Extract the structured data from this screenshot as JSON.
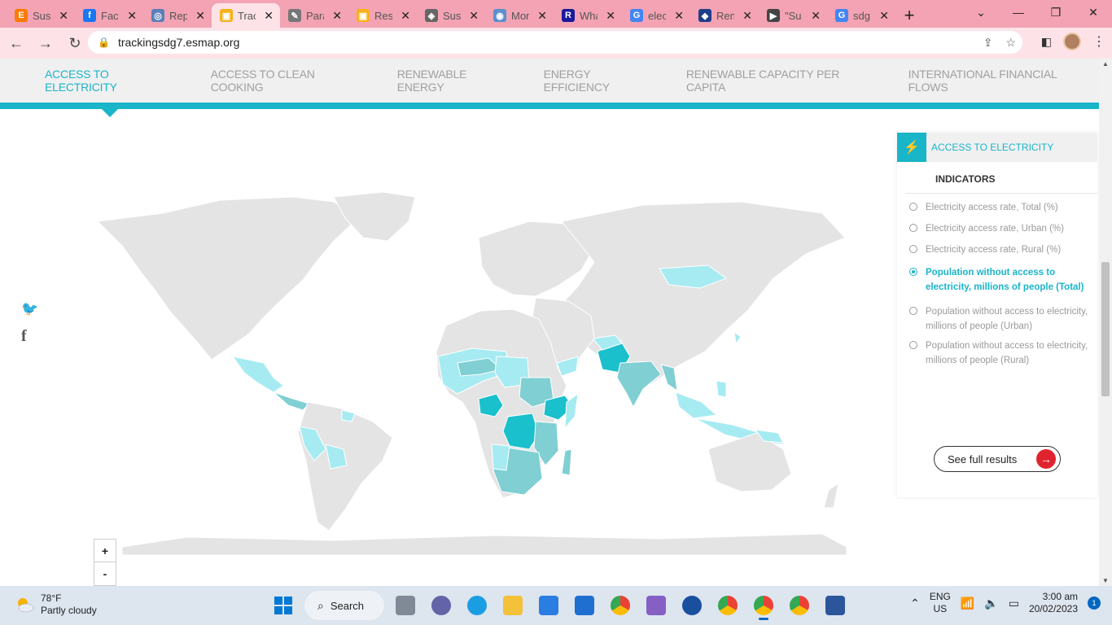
{
  "tabs": [
    {
      "title": "Sust",
      "color": "#ff7a00",
      "glyph": "E"
    },
    {
      "title": "Face",
      "color": "#1877f2",
      "glyph": "f"
    },
    {
      "title": "Rep",
      "color": "#5b7fb8",
      "glyph": "◎"
    },
    {
      "title": "Trac",
      "color": "#f6b21b",
      "glyph": "▣",
      "active": true
    },
    {
      "title": "Para",
      "color": "#777777",
      "glyph": "✎"
    },
    {
      "title": "Res",
      "color": "#f6b21b",
      "glyph": "▣"
    },
    {
      "title": "Sust",
      "color": "#666666",
      "glyph": "◈"
    },
    {
      "title": "Mon",
      "color": "#5b8fd0",
      "glyph": "◉"
    },
    {
      "title": "Wha",
      "color": "#1a1a9a",
      "glyph": "R"
    },
    {
      "title": "elec",
      "color": "#4285f4",
      "glyph": "G"
    },
    {
      "title": "Ren",
      "color": "#1d3e8a",
      "glyph": "◆"
    },
    {
      "title": "\"Su",
      "color": "#444444",
      "glyph": "▶"
    },
    {
      "title": "sdg",
      "color": "#4285f4",
      "glyph": "G"
    }
  ],
  "url": "trackingsdg7.esmap.org",
  "topnav": [
    "ACCESS TO ELECTRICITY",
    "ACCESS TO CLEAN COOKING",
    "RENEWABLE ENERGY",
    "ENERGY EFFICIENCY",
    "RENEWABLE CAPACITY PER CAPITA",
    "INTERNATIONAL FINANCIAL FLOWS"
  ],
  "panel": {
    "title": "ACCESS TO ELECTRICITY",
    "indicators_label": "INDICATORS",
    "options": [
      "Electricity access rate, Total (%)",
      "Electricity access rate, Urban (%)",
      "Electricity access rate, Rural (%)",
      "Population without access to electricity, millions of people (Total)",
      "Population without access to electricity, millions of people (Urban)",
      "Population without access to electricity, millions of people (Rural)"
    ],
    "selected_index": 3,
    "see_full": "See full results"
  },
  "zoom": {
    "plus": "+",
    "minus": "-"
  },
  "colors": {
    "accent": "#19b5c9",
    "map_base": "#e4e4e4",
    "map_light": "#a6ebf2",
    "map_mid": "#7fcfd3",
    "map_dark": "#1ac0cc",
    "cta": "#e0242f"
  },
  "taskbar": {
    "temp": "78°F",
    "weather": "Partly cloudy",
    "search": "Search",
    "lang1": "ENG",
    "lang2": "US",
    "time": "3:00 am",
    "date": "20/02/2023",
    "notifications": "1"
  }
}
